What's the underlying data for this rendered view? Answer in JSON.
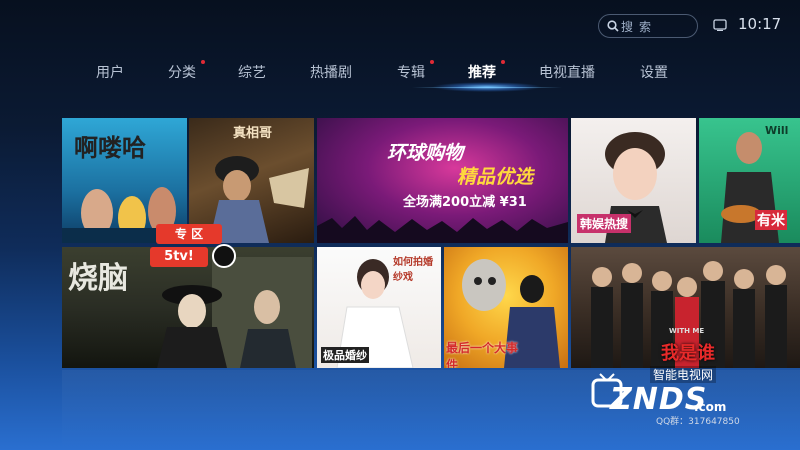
{
  "search": {
    "label": "搜索"
  },
  "status": {
    "time": "10:17"
  },
  "nav": {
    "items": [
      {
        "label": "用户"
      },
      {
        "label": "分类"
      },
      {
        "label": "综艺"
      },
      {
        "label": "热播剧"
      },
      {
        "label": "专辑"
      },
      {
        "label": "推荐"
      },
      {
        "label": "电视直播"
      },
      {
        "label": "设置"
      }
    ],
    "active": "推荐"
  },
  "tiles": {
    "t1": {
      "title": "啊喽哈"
    },
    "t2": {
      "title": "真相哥"
    },
    "t3": {
      "line1": "环球购物",
      "line2": "精品优选",
      "line3": "全场满200立减 ¥31"
    },
    "t4": {
      "title": "韩娱热搜"
    },
    "t5": {
      "title": "Will",
      "sub": "有米"
    },
    "t6": {
      "badge": "专 区",
      "brand": "5tv!",
      "title": "烧脑"
    },
    "t7": {
      "title": "如何拍婚纱戏",
      "sub": "极品婚纱"
    },
    "t8": {
      "title": "最后一个大事件"
    },
    "t9": {
      "title": "我是谁",
      "sub": "WITH ME"
    }
  },
  "watermark": {
    "cn": "智能电视网",
    "logo": "ZNDS",
    "com": ".com",
    "qq": "QQ群：317647850"
  }
}
